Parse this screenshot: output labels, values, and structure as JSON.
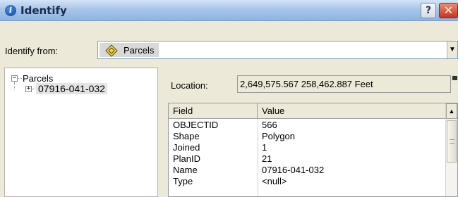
{
  "window": {
    "title": "Identify",
    "help_label": "?",
    "close_label": "✕"
  },
  "identify_from": {
    "label": "Identify from:",
    "selected": "Parcels"
  },
  "tree": {
    "root": "Parcels",
    "child": "07916-041-032"
  },
  "location": {
    "label": "Location:",
    "value": "2,649,575.567  258,462.887 Feet"
  },
  "grid": {
    "headers": {
      "field": "Field",
      "value": "Value"
    },
    "rows": [
      {
        "field": "OBJECTID",
        "value": "566"
      },
      {
        "field": "Shape",
        "value": "Polygon"
      },
      {
        "field": "Joined",
        "value": "1"
      },
      {
        "field": "PlanID",
        "value": "21"
      },
      {
        "field": "Name",
        "value": "07916-041-032"
      },
      {
        "field": "Type",
        "value": "<null>"
      }
    ]
  },
  "icons": {
    "title": "info-icon",
    "layer": "layer-diamond-icon"
  },
  "colors": {
    "titlebar": "#a8c6ea",
    "close": "#c9331c",
    "info": "#0a3fa8"
  }
}
